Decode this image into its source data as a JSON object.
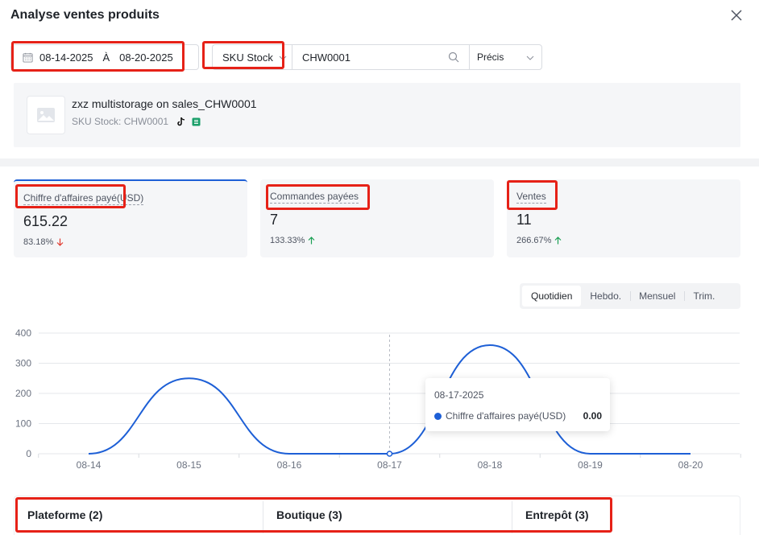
{
  "dialog": {
    "title": "Analyse ventes produits"
  },
  "filters": {
    "date_start": "08-14-2025",
    "date_separator": "À",
    "date_end": "08-20-2025",
    "search_type": "SKU Stock",
    "search_value": "CHW0001",
    "match_mode": "Précis"
  },
  "product": {
    "name": "zxz multistorage on sales_CHW0001",
    "sku_label": "SKU Stock: CHW0001"
  },
  "kpis": [
    {
      "label": "Chiffre d'affaires payé(USD)",
      "value": "615.22",
      "delta": "83.18%",
      "direction": "down",
      "color": "#e03c31"
    },
    {
      "label": "Commandes payées",
      "value": "7",
      "delta": "133.33%",
      "direction": "up",
      "color": "#1a9f53"
    },
    {
      "label": "Ventes",
      "value": "11",
      "delta": "266.67%",
      "direction": "up",
      "color": "#1a9f53"
    }
  ],
  "period_tabs": [
    "Quotidien",
    "Hebdo.",
    "Mensuel",
    "Trim."
  ],
  "active_period": "Quotidien",
  "chart_data": {
    "type": "line",
    "x": [
      "08-14",
      "08-15",
      "08-16",
      "08-17",
      "08-18",
      "08-19",
      "08-20"
    ],
    "series": [
      {
        "name": "Chiffre d'affaires payé(USD)",
        "values": [
          0,
          250,
          0,
          0,
          360,
          0,
          0
        ],
        "color": "#1d5fd6"
      }
    ],
    "yticks": [
      0,
      100,
      200,
      300,
      400
    ],
    "ylim": [
      0,
      400
    ],
    "grid": true,
    "hover_index": 3
  },
  "tooltip": {
    "date": "08-17-2025",
    "series_label": "Chiffre d'affaires payé(USD)",
    "value": "0.00"
  },
  "bottom_tabs": [
    "Plateforme (2)",
    "Boutique (3)",
    "Entrepôt (3)"
  ],
  "icons": {
    "close": "close-icon",
    "calendar": "calendar-icon",
    "search": "search-icon",
    "image": "image-placeholder-icon",
    "tiktok": "tiktok-icon",
    "shop": "shop-icon"
  }
}
